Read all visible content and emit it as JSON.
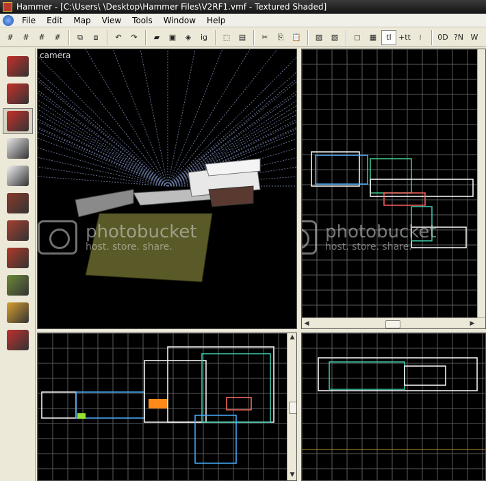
{
  "window": {
    "title": "Hammer - [C:\\Users\\ \\Desktop\\Hammer Files\\V2RF1.vmf - Textured Shaded]"
  },
  "menu": [
    "File",
    "Edit",
    "Map",
    "View",
    "Tools",
    "Window",
    "Help"
  ],
  "toolbar": {
    "items": [
      {
        "name": "grid-icon",
        "glyph": "#"
      },
      {
        "name": "grid-smaller-icon",
        "glyph": "#"
      },
      {
        "name": "grid-larger-icon",
        "glyph": "#"
      },
      {
        "name": "grid-toggle-icon",
        "glyph": "#"
      },
      {
        "sep": true
      },
      {
        "name": "group-icon",
        "glyph": "⧉"
      },
      {
        "name": "ungroup-icon",
        "glyph": "⧈"
      },
      {
        "sep": true
      },
      {
        "name": "undo-icon",
        "glyph": "↶"
      },
      {
        "name": "redo-icon",
        "glyph": "↷"
      },
      {
        "sep": true
      },
      {
        "name": "carve-icon",
        "glyph": "▰"
      },
      {
        "name": "hollow-icon",
        "glyph": "▣"
      },
      {
        "name": "texture-lock-icon",
        "glyph": "◈"
      },
      {
        "name": "ignore-groups-icon",
        "glyph": "ig"
      },
      {
        "sep": true
      },
      {
        "name": "select-icon",
        "glyph": "⬚"
      },
      {
        "name": "edit-icon",
        "glyph": "▤"
      },
      {
        "sep": true
      },
      {
        "name": "cut-icon",
        "glyph": "✂"
      },
      {
        "name": "copy-icon",
        "glyph": "⎘"
      },
      {
        "name": "paste-icon",
        "glyph": "📋"
      },
      {
        "sep": true
      },
      {
        "name": "hide-icon",
        "glyph": "▨"
      },
      {
        "name": "show-icon",
        "glyph": "▧"
      },
      {
        "sep": true
      },
      {
        "name": "bounding-box-icon",
        "glyph": "◻"
      },
      {
        "name": "entity-report-icon",
        "glyph": "▦"
      },
      {
        "name": "texture-lock-2-icon",
        "glyph": "tl",
        "active": true
      },
      {
        "name": "autosize-icon",
        "glyph": "+tt"
      },
      {
        "name": "compile-icon",
        "glyph": "⧘"
      },
      {
        "sep": true
      },
      {
        "name": "toggle-3d-icon",
        "glyph": "0D"
      },
      {
        "name": "run-map-icon",
        "glyph": "?N"
      },
      {
        "name": "vmf-icon",
        "glyph": "W"
      }
    ]
  },
  "views": {
    "camera": {
      "label": "camera"
    }
  },
  "tools": [
    {
      "name": "selection-tool",
      "color": "#c8302a"
    },
    {
      "name": "magnify-tool",
      "color": "#c8302a"
    },
    {
      "name": "camera-tool",
      "color": "#c8302a",
      "active": true
    },
    {
      "name": "entity-tool",
      "color": "#e8e8e8"
    },
    {
      "name": "block-tool",
      "color": "#f2f2f2"
    },
    {
      "name": "texture-application-tool",
      "color": "#8a3a2a"
    },
    {
      "name": "apply-texture-tool",
      "color": "#a84030"
    },
    {
      "name": "decal-tool",
      "color": "#b23a28"
    },
    {
      "name": "overlay-tool",
      "color": "#6c8a3a"
    },
    {
      "name": "clip-tool",
      "color": "#d8a030"
    },
    {
      "name": "vertex-tool",
      "color": "#c03030"
    }
  ],
  "watermark": {
    "brand": "photobucket",
    "tagline": "host. store. share."
  }
}
